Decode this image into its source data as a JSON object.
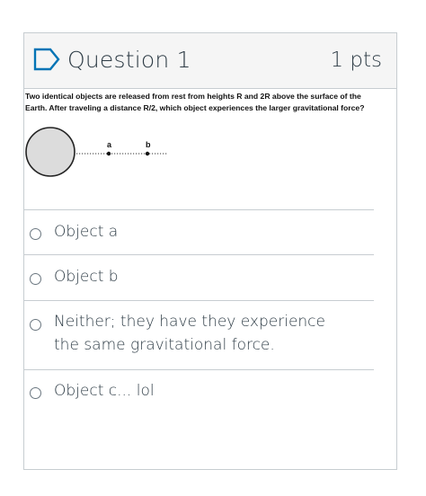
{
  "header": {
    "icon": "flag-icon",
    "title": "Question 1",
    "points": "1 pts"
  },
  "question": {
    "text_line1": "Two identical objects are released from rest from heights R and 2R above the surface of the",
    "text_line2": "Earth. After traveling a distance R/2, which object experiences the larger gravitational force?",
    "diagram": {
      "label_a": "a",
      "label_b": "b"
    }
  },
  "answers": [
    {
      "label": "Object a",
      "selected": false
    },
    {
      "label": "Object b",
      "selected": false
    },
    {
      "label": "Neither; they have they experience the same gravitational force.",
      "selected": false
    },
    {
      "label": "Object c... lol",
      "selected": false
    }
  ],
  "colors": {
    "border": "#c7cdd1",
    "header_bg": "#f5f5f5",
    "flag": "#0374b5",
    "text": "#2d3b45"
  }
}
